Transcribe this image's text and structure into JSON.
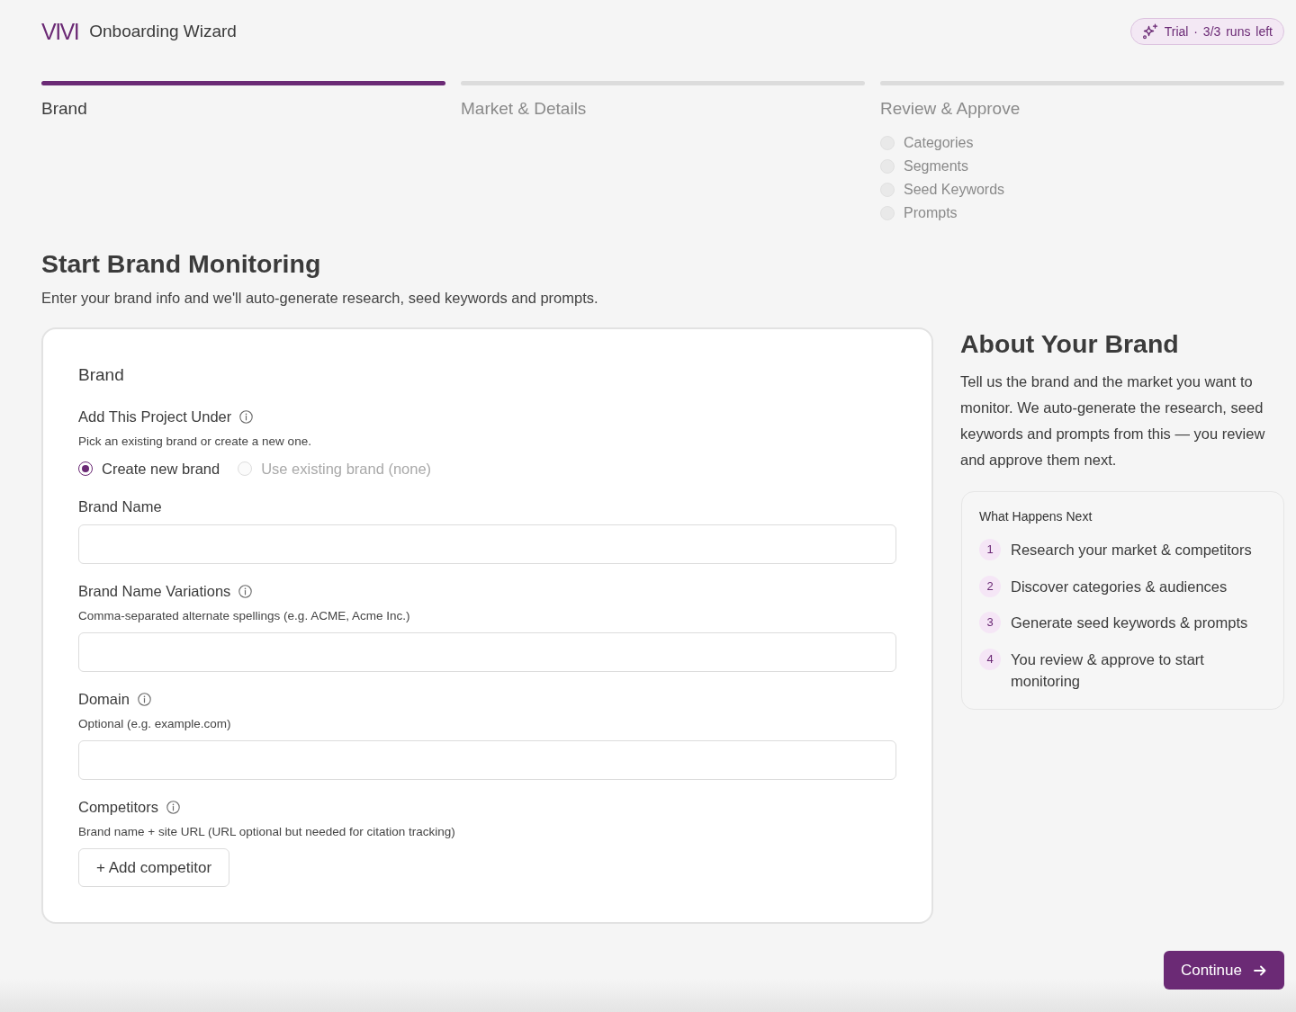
{
  "header": {
    "logo": "VIVI",
    "title": "Onboarding Wizard",
    "trial_badge": "Trial · 3/3 runs left"
  },
  "steps": [
    {
      "label": "Brand",
      "selected": true
    },
    {
      "label": "Market & Details",
      "selected": false
    },
    {
      "label": "Review & Approve",
      "selected": false,
      "substeps": [
        {
          "label": "Categories",
          "done": false
        },
        {
          "label": "Segments",
          "done": false
        },
        {
          "label": "Seed Keywords",
          "done": false
        },
        {
          "label": "Prompts",
          "done": false
        }
      ]
    }
  ],
  "intro": {
    "title": "Start Brand Monitoring",
    "subtitle": "Enter your brand info and we'll auto-generate research, seed keywords and prompts."
  },
  "form": {
    "section_title": "Brand",
    "fields": [
      {
        "kind": "radio",
        "label": "Add This Project Under",
        "info": true,
        "help": "Pick an existing brand or create a new one.",
        "options": [
          {
            "label": "Create new brand",
            "selected": true,
            "disabled": false
          },
          {
            "label": "Use existing brand (none)",
            "selected": false,
            "disabled": true
          }
        ]
      },
      {
        "kind": "text",
        "label": "Brand Name",
        "info": false
      },
      {
        "kind": "text",
        "label": "Brand Name Variations",
        "info": true,
        "help": "Comma-separated alternate spellings (e.g. ACME, Acme Inc.)"
      },
      {
        "kind": "text",
        "label": "Domain",
        "info": true,
        "help": "Optional (e.g. example.com)"
      },
      {
        "kind": "button",
        "label": "Competitors",
        "info": true,
        "help": "Brand name + site URL (URL optional but needed for citation tracking)",
        "button": "+ Add competitor"
      }
    ]
  },
  "about": {
    "title": "About Your Brand",
    "description": "Tell us the brand and the market you want to monitor. We auto-generate the research, seed keywords and prompts from this — you review and approve them next.",
    "next_steps": {
      "title": "What Happens Next",
      "items": [
        {
          "number": "1",
          "text": "Research your market & competitors"
        },
        {
          "number": "2",
          "text": "Discover categories & audiences"
        },
        {
          "number": "3",
          "text": "Generate seed keywords & prompts"
        },
        {
          "number": "4",
          "text": "You review & approve to start monitoring"
        }
      ]
    }
  },
  "footer": {
    "continue_button": "Continue"
  }
}
